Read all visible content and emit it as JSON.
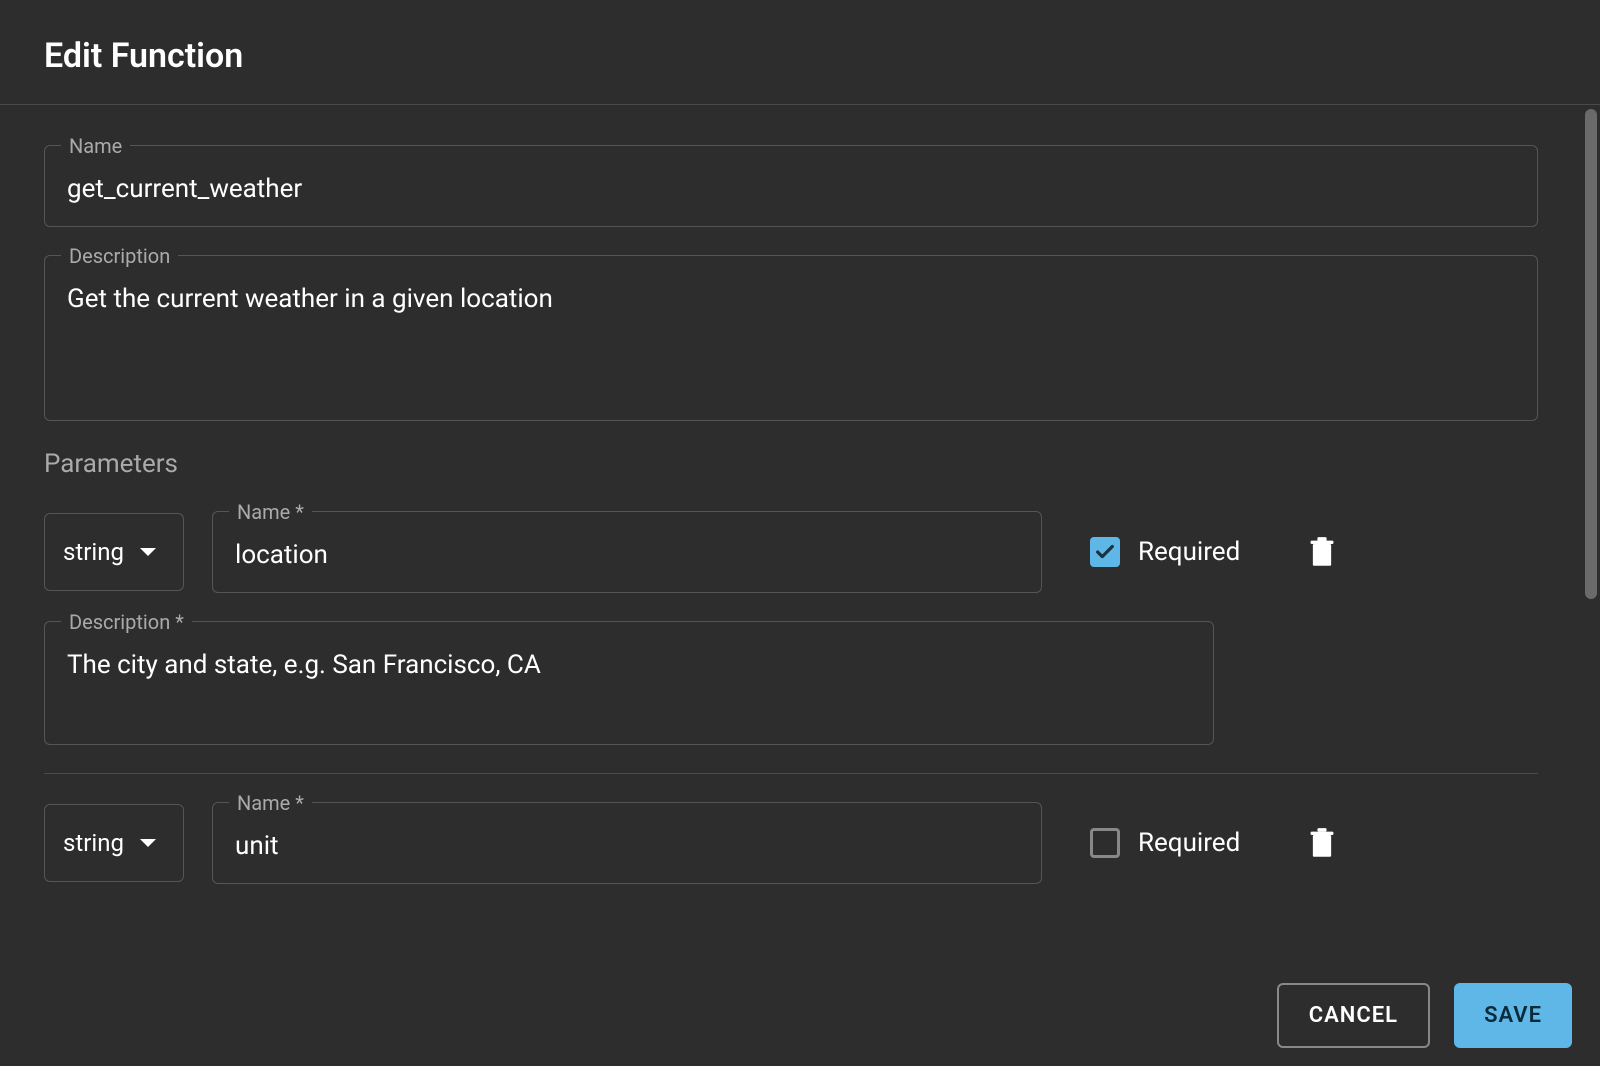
{
  "header": {
    "title": "Edit Function"
  },
  "fields": {
    "name": {
      "label": "Name",
      "value": "get_current_weather"
    },
    "description": {
      "label": "Description",
      "value": "Get the current weather in a given location"
    }
  },
  "parameters": {
    "section_title": "Parameters",
    "name_label": "Name *",
    "desc_label": "Description *",
    "required_label": "Required",
    "items": [
      {
        "type": "string",
        "name": "location",
        "description": "The city and state, e.g. San Francisco, CA",
        "required": true
      },
      {
        "type": "string",
        "name": "unit",
        "required": false
      }
    ]
  },
  "footer": {
    "cancel": "CANCEL",
    "save": "SAVE"
  }
}
